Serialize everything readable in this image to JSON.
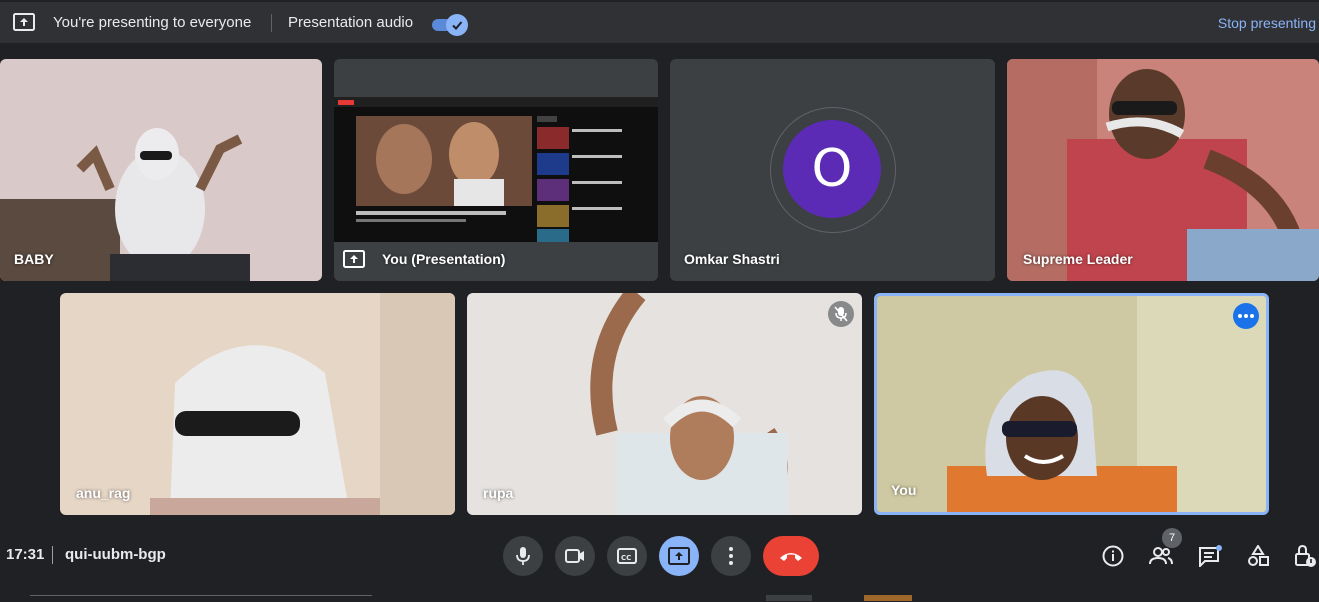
{
  "banner": {
    "presenting_message": "You're presenting to everyone",
    "audio_label": "Presentation audio",
    "audio_enabled": true,
    "stop_label": "Stop presenting"
  },
  "participants": {
    "baby": "BABY",
    "presentation": "You (Presentation)",
    "omkar": "Omkar Shastri",
    "omkar_initial": "O",
    "supreme": "Supreme Leader",
    "anu": "anu_rag",
    "rupa": "rupa",
    "you": "You"
  },
  "meeting": {
    "time": "17:31",
    "code": "qui-uubm-bgp",
    "participant_count": "7"
  },
  "colors": {
    "accent": "#8ab4f8",
    "end_call": "#ea4335",
    "avatar_bg": "#5b2bb5",
    "active_speaker_border": "#8ab4f8"
  },
  "icons": {
    "present": "present-to-all-icon",
    "mic": "mic-icon",
    "camera": "camera-icon",
    "captions": "captions-icon",
    "share": "present-screen-icon",
    "more": "more-vert-icon",
    "end": "end-call-icon",
    "info": "info-icon",
    "people": "people-icon",
    "chat": "chat-icon",
    "activities": "activities-icon",
    "host": "host-controls-icon",
    "muted": "mic-off-icon"
  }
}
